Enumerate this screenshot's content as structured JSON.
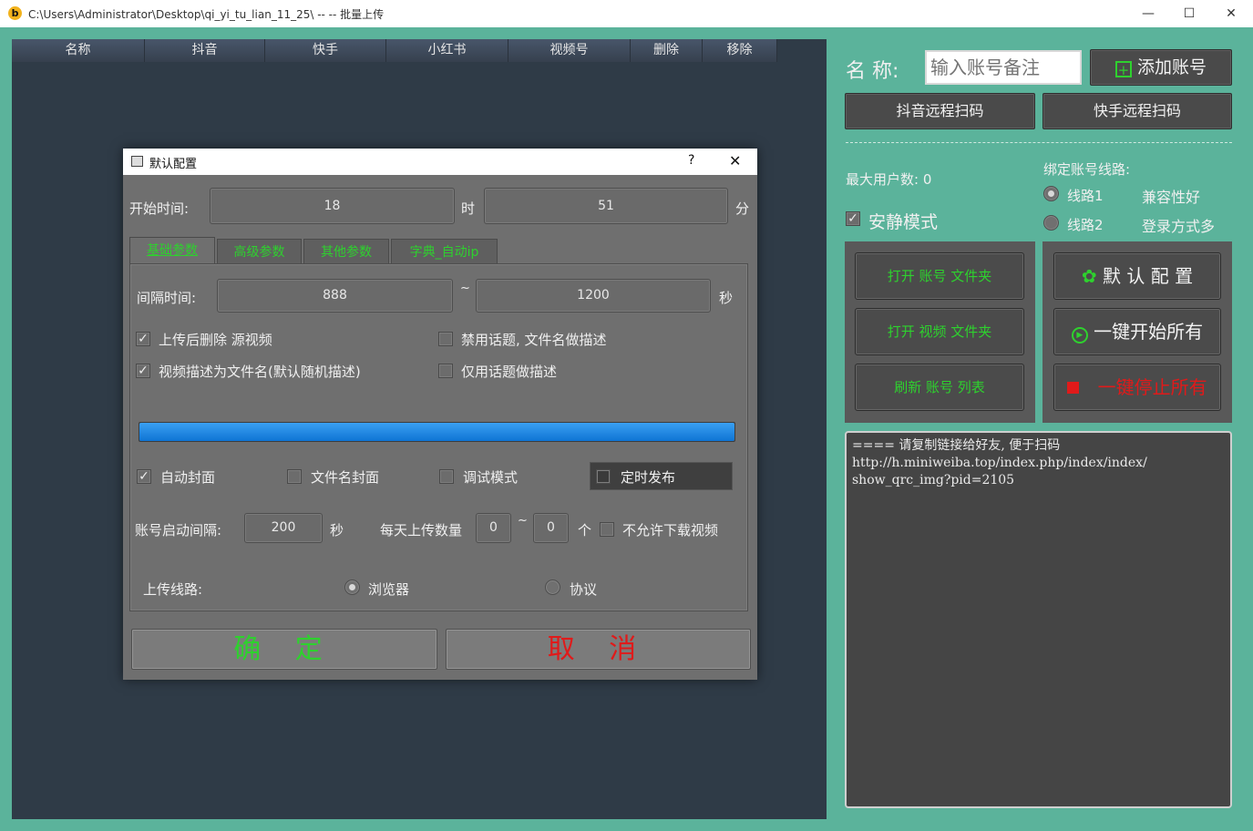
{
  "window": {
    "title": "C:\\Users\\Administrator\\Desktop\\qi_yi_tu_lian_11_25\\ -- --  批量上传",
    "app_icon": "b",
    "min": "—",
    "max": "☐",
    "close": "✕"
  },
  "table": {
    "columns": [
      "名称",
      "抖音",
      "快手",
      "小红书",
      "视频号",
      "删除",
      "移除"
    ]
  },
  "right": {
    "name_label": "名 称:",
    "name_placeholder": "输入账号备注",
    "add_account": "添加账号",
    "douyin_scan": "抖音远程扫码",
    "kuaishou_scan": "快手远程扫码",
    "max_users": "最大用户数: 0",
    "bind_line": "绑定账号线路:",
    "line1": "线路1",
    "line1_desc": "兼容性好",
    "line2": "线路2",
    "line2_desc": "登录方式多",
    "quiet_mode": "安静模式",
    "open_account_folder": "打开 账号 文件夹",
    "open_video_folder": "打开 视频 文件夹",
    "refresh_account_list": "刷新 账号 列表",
    "default_config": "默 认 配 置",
    "start_all": "一键开始所有",
    "stop_all": "一键停止所有",
    "log_text": "==== 请复制链接给好友, 便于扫码\nhttp://h.miniweiba.top/index.php/index/index/\nshow_qrc_img?pid=2105"
  },
  "dialog": {
    "title": "默认配置",
    "help": "?",
    "close": "✕",
    "start_time_label": "开始时间:",
    "hour_value": "18",
    "hour_unit": "时",
    "minute_value": "51",
    "minute_unit": "分",
    "tabs": [
      "基础参数",
      "高级参数",
      "其他参数",
      "字典_自动ip"
    ],
    "interval_label": "间隔时间:",
    "interval_min": "888",
    "interval_sep": "~",
    "interval_max": "1200",
    "interval_unit": "秒",
    "cb_delete_after_upload": "上传后删除 源视频",
    "cb_disable_topic": "禁用话题, 文件名做描述",
    "cb_desc_filename": "视频描述为文件名(默认随机描述)",
    "cb_topic_only": "仅用话题做描述",
    "progress": 1.0,
    "cb_auto_cover": "自动封面",
    "cb_filename_cover": "文件名封面",
    "cb_debug": "调试模式",
    "cb_scheduled": "定时发布",
    "account_interval_label": "账号启动间隔:",
    "account_interval_value": "200",
    "account_interval_unit": "秒",
    "daily_upload_label": "每天上传数量",
    "daily_min": "0",
    "daily_sep": "~",
    "daily_max": "0",
    "daily_unit": "个",
    "cb_no_download": "不允许下载视频",
    "upload_line_label": "上传线路:",
    "radio_browser": "浏览器",
    "radio_protocol": "协议",
    "ok": "确 定",
    "cancel": "取 消"
  },
  "colors": {
    "green_text": "#2ed12e",
    "red_text": "#e01a1a",
    "progress": "#1a86e6",
    "background": "#5bb39b"
  }
}
